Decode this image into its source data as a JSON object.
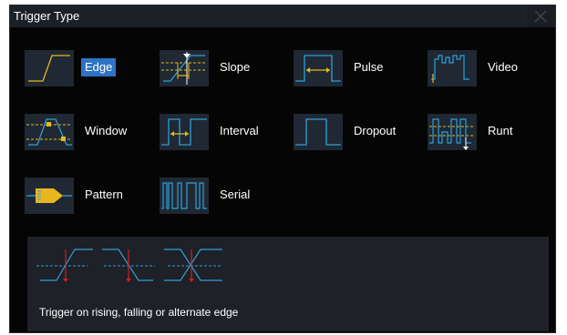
{
  "dialog": {
    "title": "Trigger Type"
  },
  "colors": {
    "waveform_yellow": "#e8b71f",
    "waveform_blue": "#2fa0d8",
    "selection": "#2e73c6",
    "marker_red": "#d02020"
  },
  "options": [
    {
      "label": "Edge",
      "icon": "edge-trigger-icon",
      "selected": true
    },
    {
      "label": "Slope",
      "icon": "slope-trigger-icon",
      "selected": false
    },
    {
      "label": "Pulse",
      "icon": "pulse-trigger-icon",
      "selected": false
    },
    {
      "label": "Video",
      "icon": "video-trigger-icon",
      "selected": false
    },
    {
      "label": "Window",
      "icon": "window-trigger-icon",
      "selected": false
    },
    {
      "label": "Interval",
      "icon": "interval-trigger-icon",
      "selected": false
    },
    {
      "label": "Dropout",
      "icon": "dropout-trigger-icon",
      "selected": false
    },
    {
      "label": "Runt",
      "icon": "runt-trigger-icon",
      "selected": false
    },
    {
      "label": "Pattern",
      "icon": "pattern-trigger-icon",
      "selected": false
    },
    {
      "label": "Serial",
      "icon": "serial-trigger-icon",
      "selected": false
    }
  ],
  "description": {
    "text": "Trigger on rising, falling or alternate edge",
    "graphic": "edge-modes-diagram"
  }
}
